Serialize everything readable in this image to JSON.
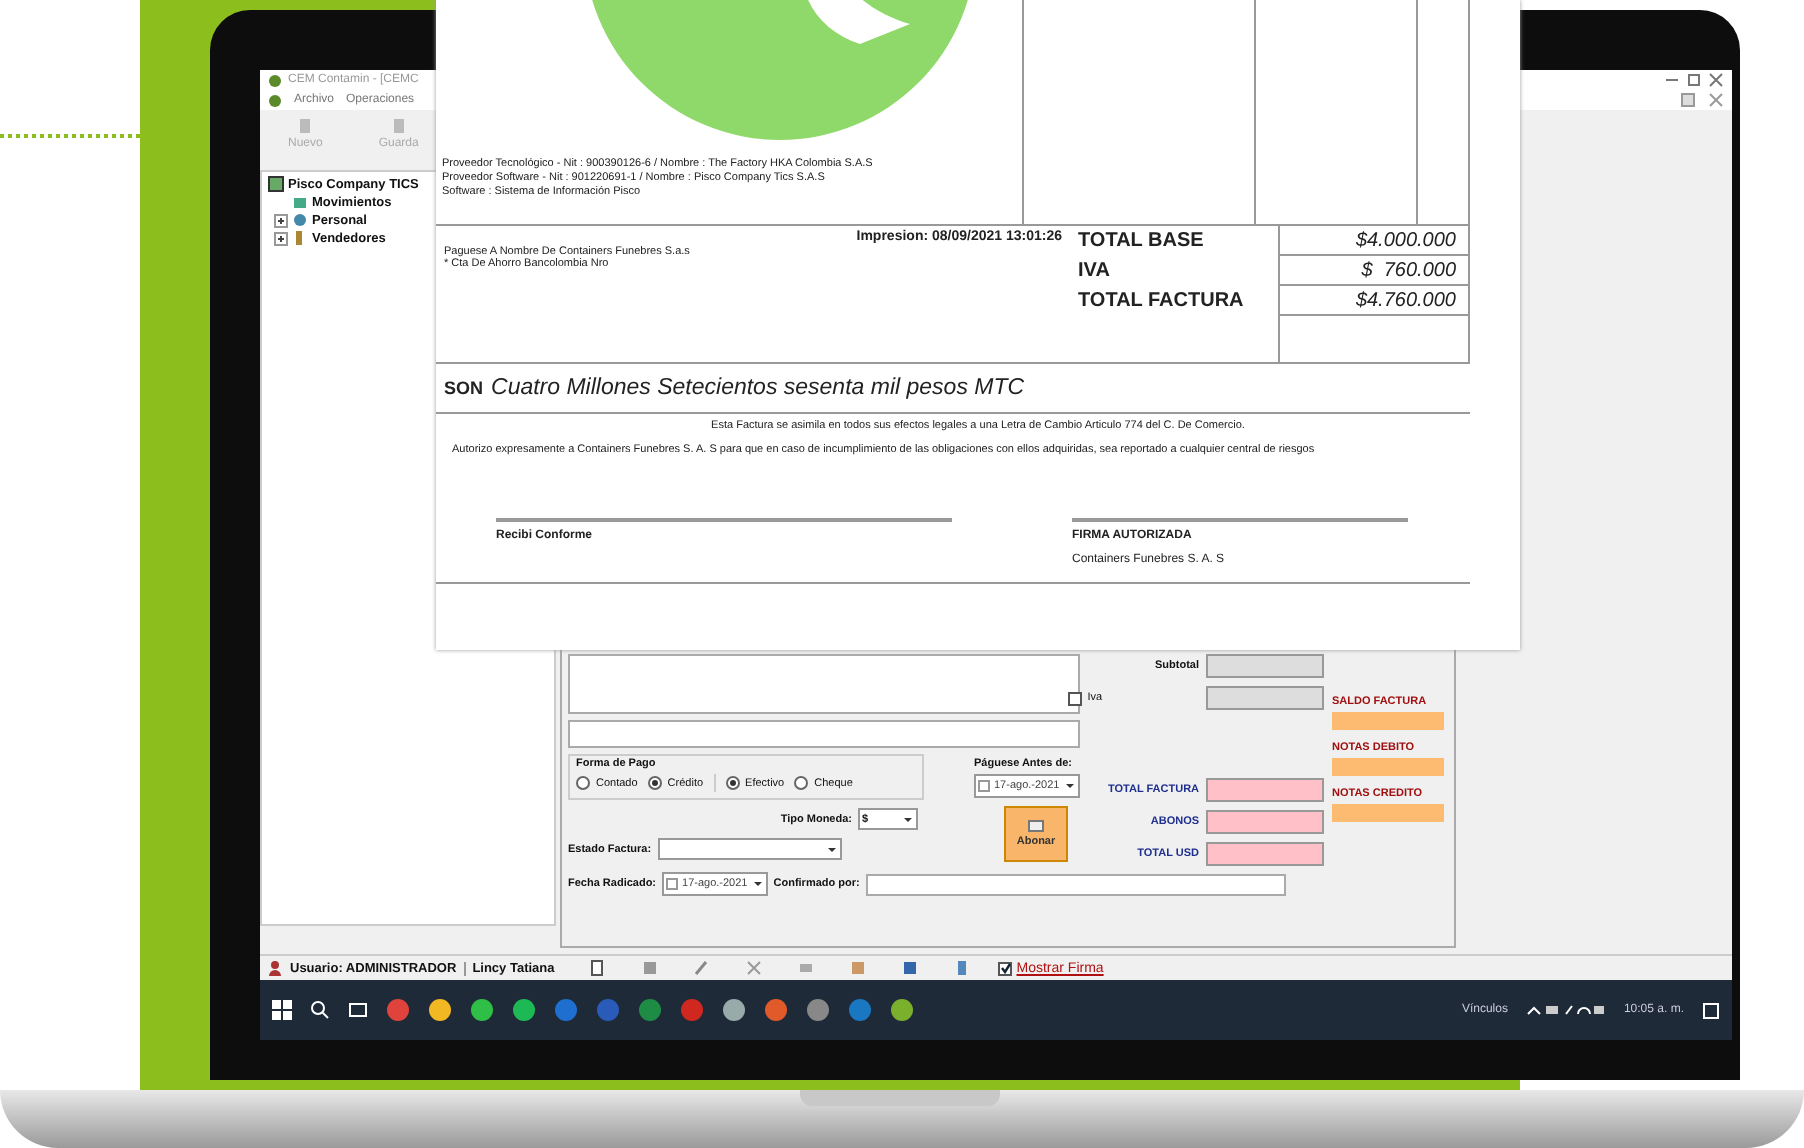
{
  "app": {
    "title": "CEM Contamin - [CEMC",
    "menu": [
      "Archivo",
      "Operaciones"
    ],
    "toolbar": [
      {
        "label": "Nuevo",
        "disabled": true
      },
      {
        "label": "Guarda",
        "disabled": true
      }
    ],
    "tree": {
      "label": "Pisco Company TICS",
      "children": [
        {
          "label": "Movimientos"
        },
        {
          "label": "Personal",
          "expanded": false
        },
        {
          "label": "Vendedores",
          "expanded": false
        }
      ]
    }
  },
  "invoice": {
    "provider_lines": [
      "Proveedor Tecnológico - Nit : 900390126-6 / Nombre : The Factory HKA Colombia S.A.S",
      "Proveedor Software - Nit : 901220691-1 / Nombre : Pisco Company Tics S.A.S",
      "Software : Sistema de Información Pisco"
    ],
    "printed": "Impresion: 08/09/2021 13:01:26",
    "payment_notes": [
      "Paguese A Nombre De Containers Funebres S.a.s",
      "* Cta De Ahorro Bancolombia Nro"
    ],
    "totals": [
      {
        "label": "TOTAL BASE",
        "value": "$4.000.000"
      },
      {
        "label": "IVA",
        "value": "$  760.000"
      },
      {
        "label": "TOTAL FACTURA",
        "value": "$4.760.000"
      }
    ],
    "amount_words_label": "SON",
    "amount_words": "Cuatro Millones Setecientos sesenta mil pesos MTC",
    "legal_notice": "Esta Factura se asimila en todos sus efectos legales a una Letra de Cambio Articulo 774 del C. De Comercio.",
    "authorization": "Autorizo expresamente a Containers Funebres S. A. S  para que en caso de incumplimiento de las obligaciones con ellos adquiridas, sea reportado a cualquier central de riesgos",
    "receiver_signature": "Recibi Conforme",
    "authorized_signature": "FIRMA AUTORIZADA",
    "company": "Containers Funebres S. A. S"
  },
  "form": {
    "subtotal_label": "Subtotal",
    "iva": {
      "label": "Iva",
      "checked": false
    },
    "payment_group": {
      "title": "Forma de Pago",
      "terms": [
        {
          "label": "Contado",
          "selected": false
        },
        {
          "label": "Crédito",
          "selected": true
        }
      ],
      "methods": [
        {
          "label": "Efectivo",
          "selected": true
        },
        {
          "label": "Cheque",
          "selected": false
        }
      ]
    },
    "due_date": {
      "label": "Páguese Antes de:",
      "value": "17-ago.-2021"
    },
    "currency": {
      "label": "Tipo Moneda:",
      "value": "$"
    },
    "invoice_state": {
      "label": "Estado Factura:"
    },
    "filed_date": {
      "label": "Fecha Radicado:",
      "value": "17-ago.-2021"
    },
    "confirmed_by": {
      "label": "Confirmado por:"
    },
    "pay_button": "Abonar",
    "totals": [
      "TOTAL FACTURA",
      "ABONOS",
      "TOTAL USD"
    ],
    "balances": [
      "SALDO FACTURA",
      "NOTAS DEBITO",
      "NOTAS CREDITO"
    ]
  },
  "status_bar": {
    "user": "Usuario: ADMINISTRADOR",
    "name": "Lincy Tatiana",
    "show_signature": {
      "label": "Mostrar Firma",
      "checked": true
    }
  },
  "taskbar": {
    "links": "Vínculos",
    "time": "10:05 a. m."
  }
}
